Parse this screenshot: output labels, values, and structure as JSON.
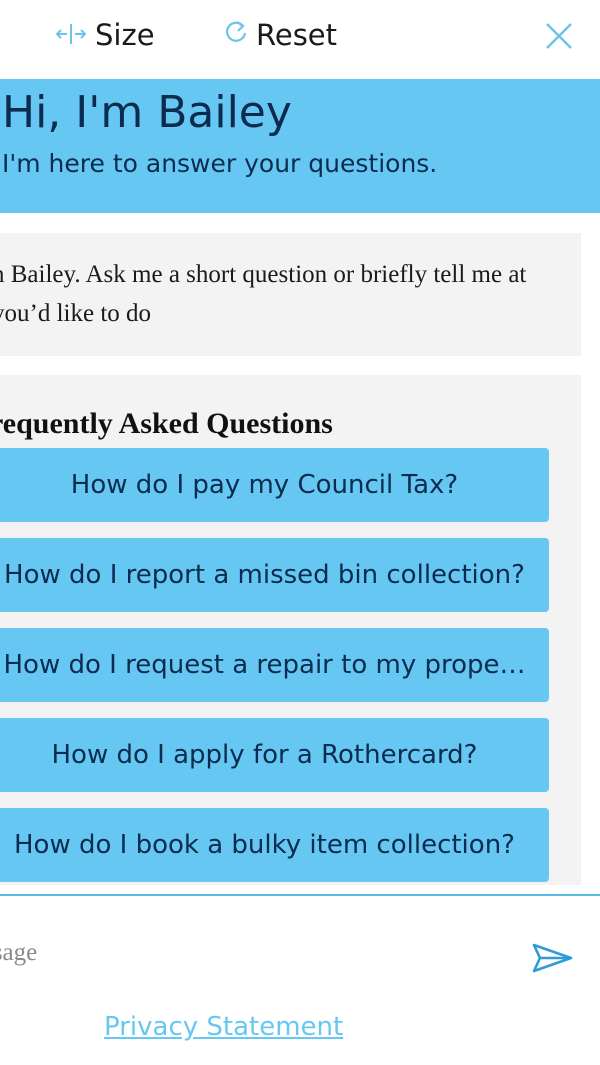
{
  "toolbar": {
    "size_label": "Size",
    "reset_label": "Reset",
    "size_icon": "resize-horizontal-icon",
    "reset_icon": "refresh-icon",
    "close_icon": "close-icon"
  },
  "banner": {
    "title": "Hi, I'm Bailey",
    "subtitle": "I'm here to answer your questions."
  },
  "welcome_message": "n Bailey. Ask me a short question or briefly tell me at you’d like to do",
  "faq": {
    "title": "requently Asked Questions",
    "items": [
      {
        "label": "How do I pay my Council Tax?"
      },
      {
        "label": "How do I report a missed bin collection?"
      },
      {
        "label": "How do I request a repair to my prope…"
      },
      {
        "label": "How do I apply for a Rothercard?"
      },
      {
        "label": "How do I book a bulky item collection?"
      }
    ]
  },
  "composer": {
    "placeholder": "essage",
    "send_icon": "send-icon"
  },
  "footer": {
    "privacy_label": "Privacy Statement"
  },
  "colors": {
    "accent": "#66c8f2",
    "text_dark": "#0c2c4f",
    "panel": "#f3f3f3"
  }
}
